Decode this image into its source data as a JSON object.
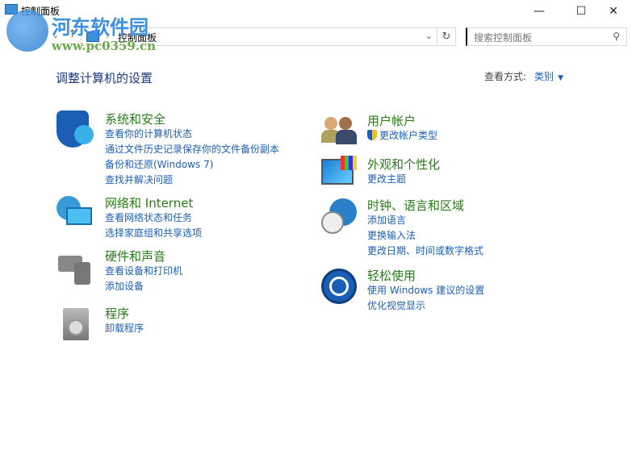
{
  "window": {
    "title": "控制面板",
    "minimize": "—",
    "maximize": "☐",
    "close": "✕"
  },
  "address": {
    "breadcrumb": "控制面板",
    "refresh": "↻"
  },
  "search": {
    "placeholder": "搜索控制面板"
  },
  "watermark": {
    "name": "河东软件园",
    "url": "www.pc0359.cn"
  },
  "main": {
    "heading": "调整计算机的设置",
    "view_label": "查看方式:",
    "view_value": "类别"
  },
  "categories": [
    {
      "title": "系统和安全",
      "links": [
        "查看你的计算机状态",
        "通过文件历史记录保存你的文件备份副本",
        "备份和还原(Windows 7)",
        "查找并解决问题"
      ]
    },
    {
      "title": "网络和 Internet",
      "links": [
        "查看网络状态和任务",
        "选择家庭组和共享选项"
      ]
    },
    {
      "title": "硬件和声音",
      "links": [
        "查看设备和打印机",
        "添加设备"
      ]
    },
    {
      "title": "程序",
      "links": [
        "卸载程序"
      ]
    },
    {
      "title": "用户帐户",
      "links": [
        "更改帐户类型"
      ]
    },
    {
      "title": "外观和个性化",
      "links": [
        "更改主题"
      ]
    },
    {
      "title": "时钟、语言和区域",
      "links": [
        "添加语言",
        "更换输入法",
        "更改日期、时间或数字格式"
      ]
    },
    {
      "title": "轻松使用",
      "links": [
        "使用 Windows 建议的设置",
        "优化视觉显示"
      ]
    }
  ]
}
